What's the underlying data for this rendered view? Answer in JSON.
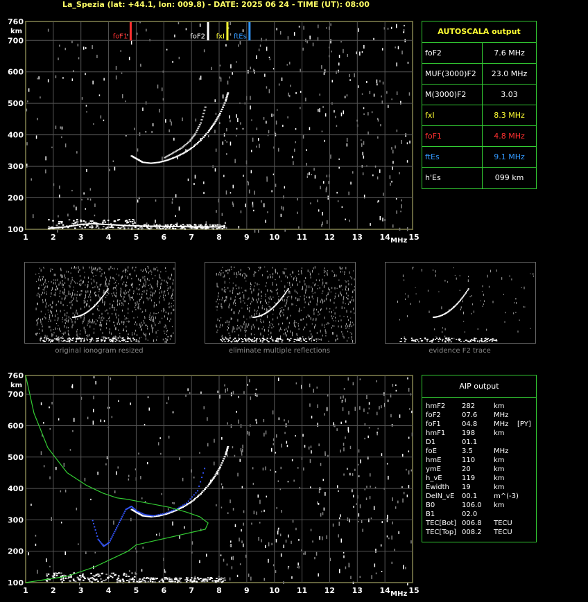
{
  "header": "La_Spezia (lat: +44.1, lon: 009.8) - DATE: 2025 06 24 - TIME (UT): 08:00",
  "chart_data": [
    {
      "type": "scatter",
      "title": "",
      "xlabel": "MHz",
      "ylabel": "km",
      "xlim": [
        1,
        15
      ],
      "ylim": [
        100,
        760
      ],
      "x_ticks": [
        "1",
        "2",
        "3",
        "4",
        "5",
        "6",
        "7",
        "8",
        "9",
        "10",
        "11",
        "12",
        "13",
        "14",
        "15"
      ],
      "y_ticks": [
        "100",
        "200",
        "300",
        "400",
        "500",
        "600",
        "700",
        "760"
      ],
      "markers": [
        {
          "label": "foF1",
          "x": 4.8,
          "color": "#ff3030"
        },
        {
          "label": "foF2",
          "x": 7.6,
          "color": "#ffffff"
        },
        {
          "label": "fxI",
          "x": 8.3,
          "color": "#ffff33"
        },
        {
          "label": "ftEs",
          "x": 9.1,
          "color": "#3399ff"
        }
      ],
      "series": [
        {
          "name": "F2 trace (ordinary)",
          "color": "#ffffff",
          "x": [
            4.8,
            5.0,
            5.2,
            5.5,
            5.8,
            6.1,
            6.4,
            6.7,
            7.0,
            7.3,
            7.6,
            7.8,
            8.0,
            8.2,
            8.3
          ],
          "y": [
            335,
            325,
            315,
            312,
            315,
            322,
            332,
            345,
            362,
            385,
            415,
            440,
            470,
            510,
            540
          ]
        },
        {
          "name": "F2 trace (extraordinary)",
          "color": "#cccccc",
          "x": [
            6.0,
            6.3,
            6.6,
            6.9,
            7.1,
            7.3,
            7.5
          ],
          "y": [
            330,
            345,
            360,
            382,
            405,
            440,
            500
          ]
        },
        {
          "name": "E/Es trace",
          "color": "#ffffff",
          "x": [
            1.8,
            2.2,
            2.6,
            3.0,
            3.4,
            3.8,
            4.2,
            4.6,
            5.0,
            5.4,
            5.8,
            6.2,
            6.6,
            7.0,
            7.4,
            7.8,
            8.0
          ],
          "y": [
            105,
            108,
            112,
            118,
            120,
            118,
            116,
            114,
            113,
            112,
            112,
            111,
            111,
            110,
            110,
            110,
            110
          ]
        }
      ]
    },
    {
      "type": "scatter",
      "title": "",
      "xlabel": "MHz",
      "ylabel": "km",
      "xlim": [
        1,
        15
      ],
      "ylim": [
        100,
        760
      ],
      "x_ticks": [
        "1",
        "2",
        "3",
        "4",
        "5",
        "6",
        "7",
        "8",
        "9",
        "10",
        "11",
        "12",
        "13",
        "14",
        "15"
      ],
      "y_ticks": [
        "100",
        "200",
        "300",
        "400",
        "500",
        "600",
        "700",
        "760"
      ],
      "series": [
        {
          "name": "Observed trace",
          "color": "#ffffff",
          "x": [
            4.8,
            5.0,
            5.2,
            5.5,
            5.8,
            6.1,
            6.4,
            6.7,
            7.0,
            7.3,
            7.6,
            7.8,
            8.0,
            8.2,
            8.3
          ],
          "y": [
            335,
            325,
            315,
            312,
            315,
            322,
            332,
            345,
            362,
            385,
            415,
            440,
            470,
            510,
            540
          ]
        },
        {
          "name": "Profile fit trace",
          "color": "#3355ff",
          "x": [
            3.4,
            3.6,
            3.8,
            4.0,
            4.2,
            4.4,
            4.6,
            4.8,
            5.0,
            5.3,
            5.6,
            6.0,
            6.4,
            6.8,
            7.2,
            7.5
          ],
          "y": [
            300,
            240,
            218,
            230,
            265,
            300,
            335,
            345,
            330,
            318,
            315,
            322,
            335,
            355,
            395,
            480
          ]
        },
        {
          "name": "Electron density profile",
          "color": "#33cc33",
          "x": [
            1.0,
            1.3,
            1.8,
            2.5,
            3.2,
            3.8,
            4.3,
            4.7,
            5.0,
            5.6,
            6.2,
            6.8,
            7.3,
            7.6,
            7.5,
            7.0,
            6.0,
            5.0,
            4.7,
            3.5,
            2.5,
            1.0
          ],
          "y": [
            760,
            640,
            530,
            450,
            410,
            385,
            370,
            365,
            360,
            350,
            340,
            325,
            310,
            290,
            270,
            260,
            240,
            220,
            200,
            150,
            120,
            100
          ]
        }
      ]
    }
  ],
  "autoscala": {
    "title": "AUTOSCALA output",
    "rows": [
      {
        "key": "foF2",
        "value": "7.6 MHz",
        "color": "#ffffff"
      },
      {
        "key": "MUF(3000)F2",
        "value": "23.0 MHz",
        "color": "#ffffff"
      },
      {
        "key": "M(3000)F2",
        "value": "3.03",
        "color": "#ffffff"
      },
      {
        "key": "fxI",
        "value": "8.3 MHz",
        "color": "#ffff33"
      },
      {
        "key": "foF1",
        "value": "4.8 MHz",
        "color": "#ff3030"
      },
      {
        "key": "ftEs",
        "value": "9.1 MHz",
        "color": "#3399ff"
      },
      {
        "key": "h'Es",
        "value": "099     km",
        "color": "#ffffff"
      }
    ]
  },
  "aip": {
    "title": "AIP output",
    "rows": [
      {
        "key": "hmF2",
        "value": "282",
        "unit": "km",
        "extra": ""
      },
      {
        "key": "foF2",
        "value": "07.6",
        "unit": "MHz",
        "extra": ""
      },
      {
        "key": "foF1",
        "value": "04.8",
        "unit": "MHz",
        "extra": "[PY]"
      },
      {
        "key": "hmF1",
        "value": "198",
        "unit": "km",
        "extra": ""
      },
      {
        "key": "D1",
        "value": "01.1",
        "unit": "",
        "extra": ""
      },
      {
        "key": "foE",
        "value": "3.5",
        "unit": "MHz",
        "extra": ""
      },
      {
        "key": "hmE",
        "value": "110",
        "unit": "km",
        "extra": ""
      },
      {
        "key": "ymE",
        "value": "20",
        "unit": "km",
        "extra": ""
      },
      {
        "key": "h_vE",
        "value": "119",
        "unit": "km",
        "extra": ""
      },
      {
        "key": "Ewidth",
        "value": "19",
        "unit": "km",
        "extra": ""
      },
      {
        "key": "DelN_vE",
        "value": "00.1",
        "unit": "m^(-3)",
        "extra": ""
      },
      {
        "key": "B0",
        "value": "106.0",
        "unit": "km",
        "extra": ""
      },
      {
        "key": "B1",
        "value": "02.0",
        "unit": "",
        "extra": ""
      },
      {
        "key": "TEC[Bot]",
        "value": "006.8",
        "unit": "TECU",
        "extra": ""
      },
      {
        "key": "TEC[Top]",
        "value": "008.2",
        "unit": "TECU",
        "extra": ""
      }
    ]
  },
  "thumbnails": [
    {
      "caption": "original ionogram resized"
    },
    {
      "caption": "eliminate multiple reflections"
    },
    {
      "caption": "evidence F2 trace"
    }
  ]
}
